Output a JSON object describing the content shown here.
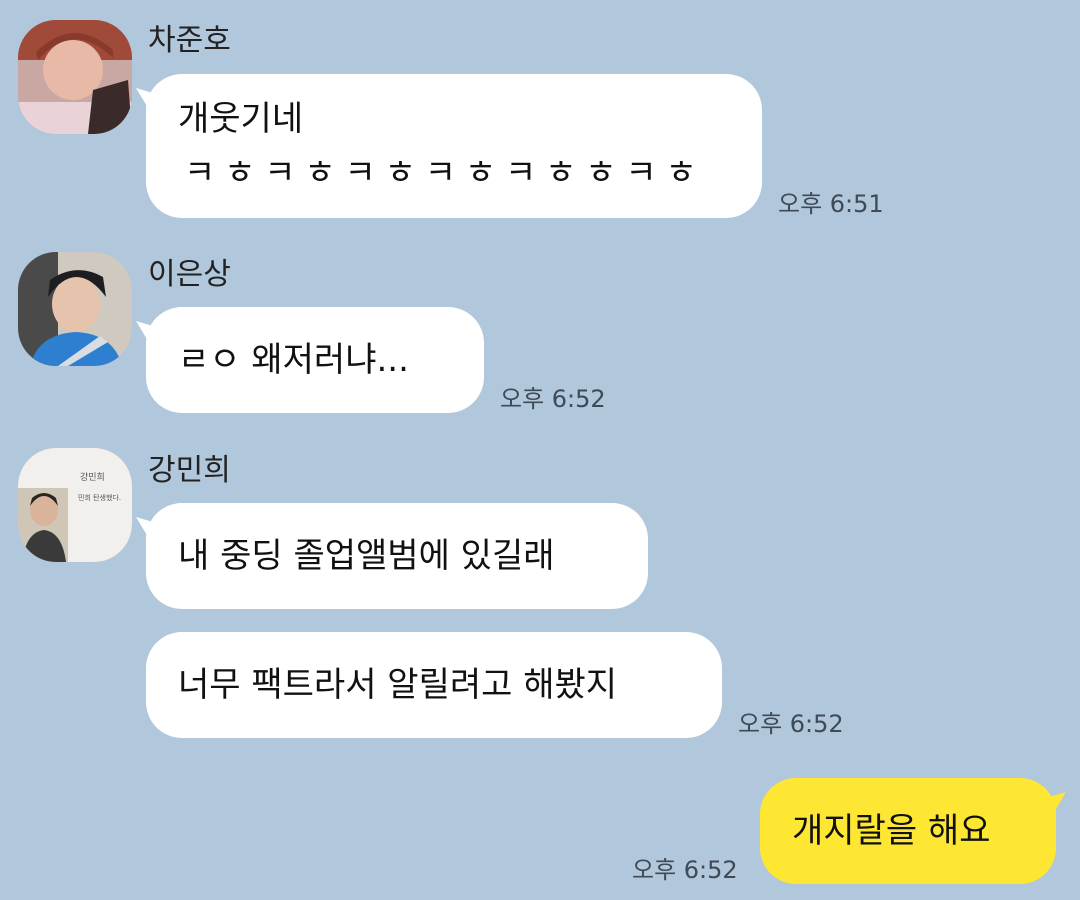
{
  "messages": [
    {
      "sender": "차준호",
      "avatar_icon": "avatar-photo-chajunho",
      "bubbles": [
        {
          "lines": [
            "개웃기네",
            "ㅋㅎㅋㅎㅋㅎㅋㅎㅋㅎㅎㅋㅎ"
          ]
        }
      ],
      "time": "오후 6:51"
    },
    {
      "sender": "이은상",
      "avatar_icon": "avatar-photo-leeeunsang",
      "bubbles": [
        {
          "lines": [
            "ㄹㅇ 왜저러냐..."
          ]
        }
      ],
      "time": "오후 6:52"
    },
    {
      "sender": "강민희",
      "avatar_icon": "avatar-photo-kangminhee",
      "avatar_text": [
        "강민희",
        "민희 탄생했다."
      ],
      "bubbles": [
        {
          "lines": [
            "내 중딩 졸업앨범에 있길래"
          ]
        },
        {
          "lines": [
            "너무 팩트라서 알릴려고 해봤지"
          ]
        }
      ],
      "time": "오후 6:52"
    },
    {
      "sender": "me",
      "bubbles": [
        {
          "lines": [
            "개지랄을 해요"
          ]
        }
      ],
      "time": "오후 6:52"
    }
  ],
  "colors": {
    "background": "#b1c7db",
    "bubble_other": "#ffffff",
    "bubble_mine": "#fee733"
  }
}
